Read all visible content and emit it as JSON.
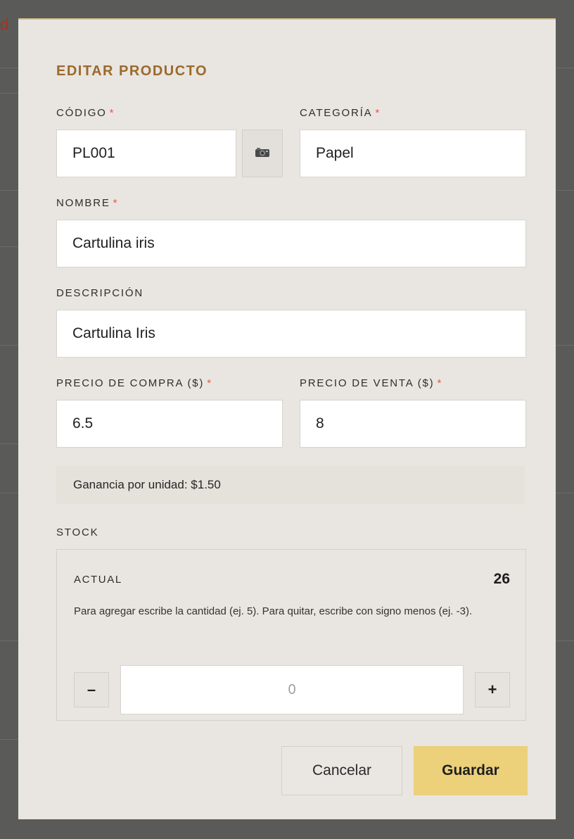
{
  "background": {
    "fragment_text": "d"
  },
  "modal": {
    "title": "EDITAR PRODUCTO",
    "required_mark": "*",
    "fields": {
      "codigo": {
        "label": "CÓDIGO",
        "value": "PL001"
      },
      "camera_button_icon": "camera-icon",
      "categoria": {
        "label": "CATEGORÍA",
        "value": "Papel"
      },
      "nombre": {
        "label": "NOMBRE",
        "value": "Cartulina iris"
      },
      "descripcion": {
        "label": "DESCRIPCIÓN",
        "value": "Cartulina Iris"
      },
      "precio_compra": {
        "label": "PRECIO DE COMPRA ($)",
        "value": "6.5"
      },
      "precio_venta": {
        "label": "PRECIO DE VENTA ($)",
        "value": "8"
      }
    },
    "gain_text": "Ganancia por unidad: $1.50",
    "stock": {
      "label": "STOCK",
      "actual_label": "ACTUAL",
      "actual_value": "26",
      "help_text": "Para agregar escribe la cantidad (ej. 5). Para quitar, escribe con signo menos (ej. -3).",
      "minus_label": "–",
      "plus_label": "+",
      "quantity_placeholder": "0"
    },
    "buttons": {
      "cancel": "Cancelar",
      "save": "Guardar"
    },
    "colors": {
      "title": "#9a6a2c",
      "required": "#e25a4a",
      "save_button": "#ecd07a",
      "modal_bg": "#e9e5e0"
    }
  }
}
